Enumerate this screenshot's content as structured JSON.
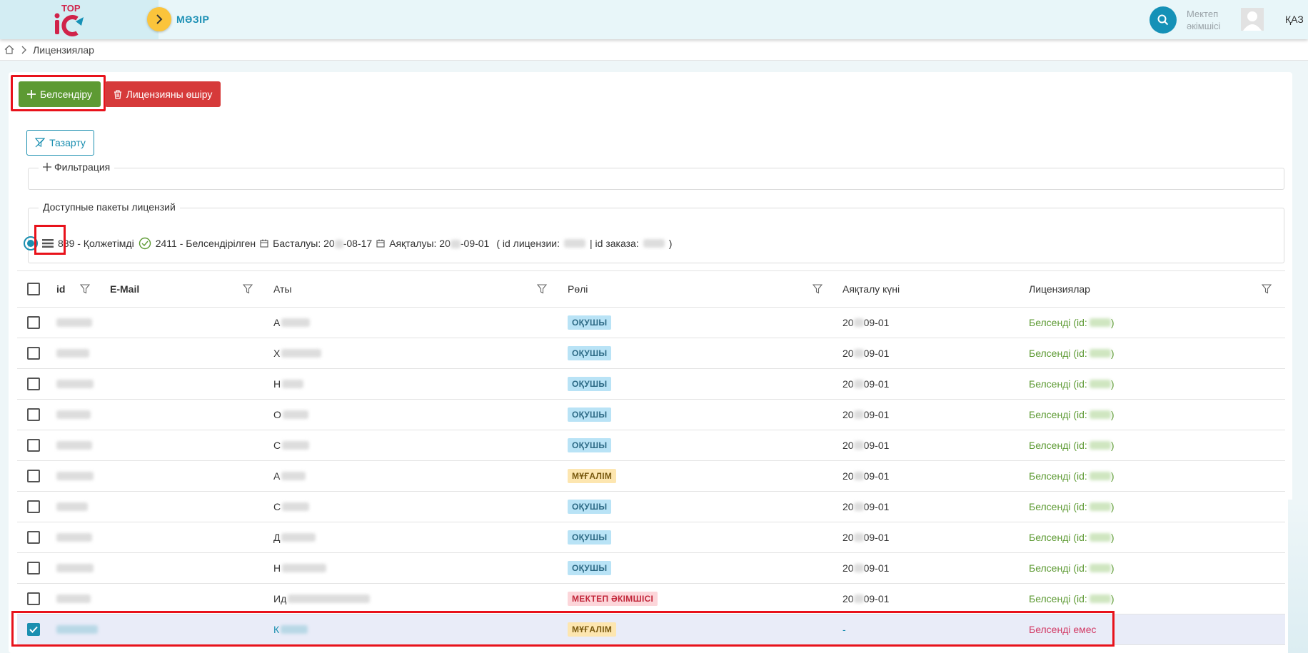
{
  "header": {
    "logo_top": "TOP",
    "menu_label": "МӘЗІР",
    "role_line1": "Мектеп",
    "role_line2": "әкімшісі",
    "language": "ҚАЗ"
  },
  "breadcrumb": {
    "current": "Лицензиялар"
  },
  "toolbar": {
    "activate_label": "Белсендіру",
    "delete_label": "Лицензияны өшіру",
    "clear_label": "Тазарту"
  },
  "filter": {
    "legend": "Фильтрация"
  },
  "packages": {
    "legend": "Доступные пакеты лицензий",
    "available": "889 - Қолжетімді",
    "activated": "2411 - Белсендірілген",
    "start_prefix": "Басталуы: 20",
    "start_suffix": "-08-17",
    "end_prefix": "Аяқталуы: 20",
    "end_suffix": "-09-01",
    "license_id_label": "( id лицензии:",
    "order_id_label": "| id заказа:",
    "close_paren": ")"
  },
  "table": {
    "columns": {
      "id": "id",
      "email": "E-Mail",
      "name": "Аты",
      "role": "Рөлі",
      "end_date": "Аяқталу күні",
      "licenses": "Лицензиялар"
    },
    "date_prefix": "20",
    "date_suffix": "09-01",
    "lic_active_prefix": "Белсенді (id:",
    "lic_active_suffix": ")",
    "rows": [
      {
        "initial": "А",
        "role": "ОҚУШЫ",
        "role_kind": "student",
        "checked": false
      },
      {
        "initial": "Х",
        "role": "ОҚУШЫ",
        "role_kind": "student",
        "checked": false
      },
      {
        "initial": "Н",
        "role": "ОҚУШЫ",
        "role_kind": "student",
        "checked": false
      },
      {
        "initial": "О",
        "role": "ОҚУШЫ",
        "role_kind": "student",
        "checked": false
      },
      {
        "initial": "С",
        "role": "ОҚУШЫ",
        "role_kind": "student",
        "checked": false
      },
      {
        "initial": "А",
        "role": "МҰҒАЛІМ",
        "role_kind": "teacher",
        "checked": false
      },
      {
        "initial": "С",
        "role": "ОҚУШЫ",
        "role_kind": "student",
        "checked": false
      },
      {
        "initial": "Д",
        "role": "ОҚУШЫ",
        "role_kind": "student",
        "checked": false
      },
      {
        "initial": "Н",
        "role": "ОҚУШЫ",
        "role_kind": "student",
        "checked": false
      },
      {
        "initial": "Ид",
        "role": "МЕКТЕП ӘКІМШІСІ",
        "role_kind": "admin",
        "checked": false
      }
    ],
    "selected_row": {
      "initial": "К",
      "role": "МҰҒАЛІМ",
      "end_date": "-",
      "license": "Белсенді емес"
    }
  },
  "colors": {
    "primary": "#1b8fb0",
    "success": "#5d9a33",
    "danger": "#d63a3a",
    "highlight": "#e8121b"
  }
}
